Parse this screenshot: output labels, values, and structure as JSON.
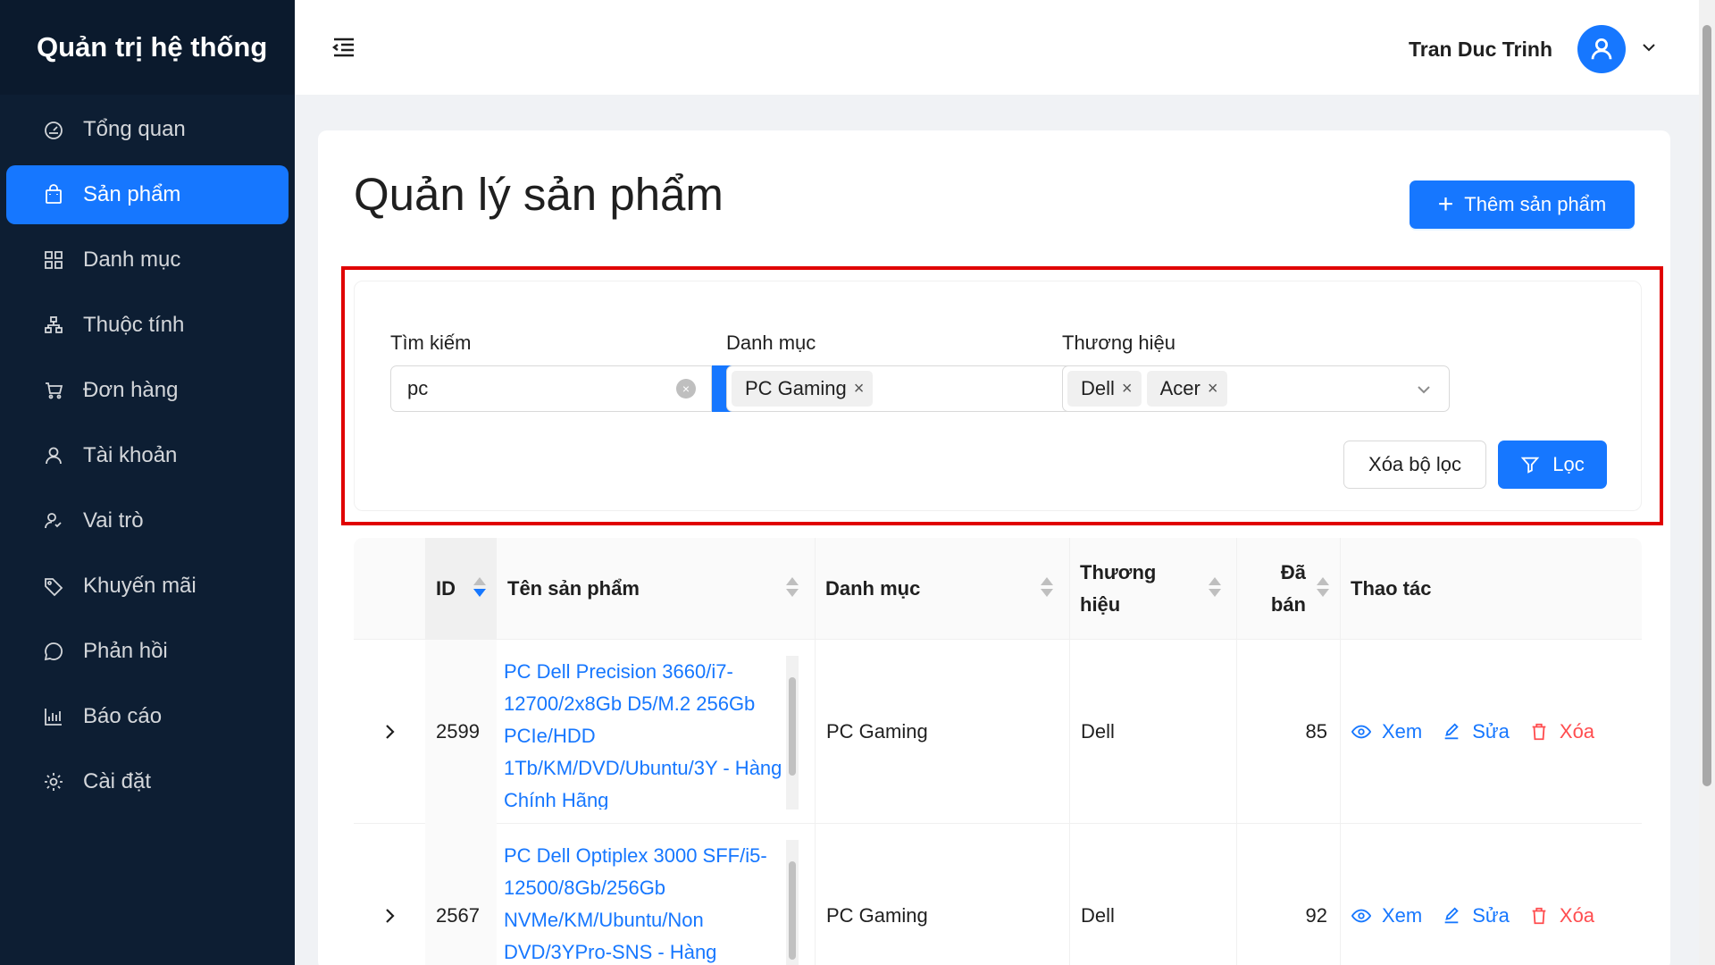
{
  "app_title": "Quản trị hệ thống",
  "sidebar": {
    "items": [
      {
        "label": "Tổng quan",
        "icon": "dashboard-icon"
      },
      {
        "label": "Sản phẩm",
        "icon": "shopping-bag-icon",
        "active": true
      },
      {
        "label": "Danh mục",
        "icon": "grid-icon"
      },
      {
        "label": "Thuộc tính",
        "icon": "cluster-icon"
      },
      {
        "label": "Đơn hàng",
        "icon": "cart-icon"
      },
      {
        "label": "Tài khoản",
        "icon": "user-icon"
      },
      {
        "label": "Vai trò",
        "icon": "team-icon"
      },
      {
        "label": "Khuyến mãi",
        "icon": "tag-icon"
      },
      {
        "label": "Phản hồi",
        "icon": "message-icon"
      },
      {
        "label": "Báo cáo",
        "icon": "bar-chart-icon"
      },
      {
        "label": "Cài đặt",
        "icon": "settings-icon"
      }
    ]
  },
  "header": {
    "user_name": "Tran Duc Trinh"
  },
  "page": {
    "title": "Quản lý sản phẩm",
    "add_button": "Thêm sản phẩm"
  },
  "filters": {
    "search_label": "Tìm kiếm",
    "search_value": "pc",
    "category_label": "Danh mục",
    "category_tags": [
      "PC Gaming"
    ],
    "brand_label": "Thương hiệu",
    "brand_tags": [
      "Dell",
      "Acer"
    ],
    "clear_button": "Xóa bộ lọc",
    "filter_button": "Lọc"
  },
  "table": {
    "columns": [
      "ID",
      "Tên sản phẩm",
      "Danh mục",
      "Thương hiệu",
      "Đã bán",
      "Thao tác"
    ],
    "rows": [
      {
        "id": "2599",
        "name": "PC Dell Precision 3660/i7-12700/2x8Gb D5/M.2 256Gb PCIe/HDD 1Tb/KM/DVD/Ubuntu/3Y - Hàng Chính Hãng",
        "category": "PC Gaming",
        "brand": "Dell",
        "sold": "85"
      },
      {
        "id": "2567",
        "name": "PC Dell Optiplex 3000 SFF/i5-12500/8Gb/256Gb NVMe/KM/Ubuntu/Non DVD/3YPro-SNS - Hàng",
        "category": "PC Gaming",
        "brand": "Dell",
        "sold": "92"
      }
    ],
    "actions": {
      "view": "Xem",
      "edit": "Sửa",
      "delete": "Xóa"
    }
  },
  "colors": {
    "primary": "#1677ff",
    "sidebar": "#0d1e33",
    "danger": "#ff4d4f",
    "highlight": "#e00000"
  }
}
